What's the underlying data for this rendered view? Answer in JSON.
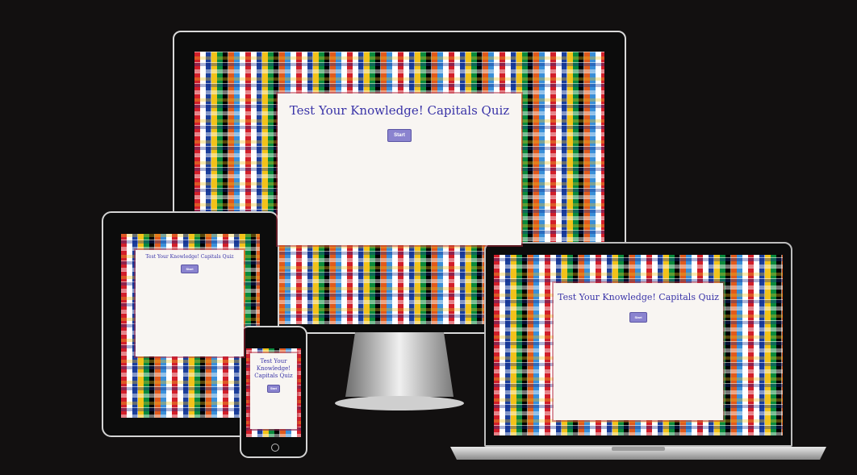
{
  "app": {
    "title": "Test Your Knowledge! Capitals Quiz",
    "start_label": "Start",
    "phone_title_lines": [
      "Test Your",
      "Knowledge!",
      "Capitals Quiz"
    ]
  },
  "colors": {
    "background": "#121010",
    "card": "#f8f5f2",
    "title": "#3a34a8",
    "button": "#8a83cf"
  }
}
